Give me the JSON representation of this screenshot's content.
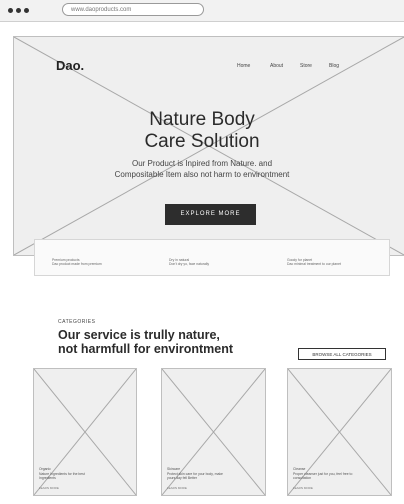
{
  "browser": {
    "url": "www.daoproducts.com"
  },
  "nav": {
    "logo": "Dao.",
    "items": [
      "Home",
      "About",
      "Store",
      "Blog"
    ]
  },
  "hero": {
    "title_line1": "Nature Body",
    "title_line2": "Care Solution",
    "subtitle_line1": "Our Product is Inpired from Nature. and",
    "subtitle_line2": "Compositable Item also not harm to environtment",
    "cta": "EXPLORE MORE"
  },
  "features": [
    {
      "line1": "Premium products",
      "line2": "Dao product made from premium"
    },
    {
      "line1": "Dry in natural",
      "line2": "Don't dry yo, face naturally"
    },
    {
      "line1": "Goody for planet",
      "line2": "Dao minimal treatment to our planet"
    }
  ],
  "categories": {
    "label": "CATEGORIES",
    "title_line1": "Our service is trully nature,",
    "title_line2": "not harmfull for environtment",
    "browse": "BROWSE ALL CATEGORIES",
    "cards": [
      {
        "tag": "Organic",
        "desc": "Nature Ingredients for the best Ingredients",
        "link": "LEARN MORE"
      },
      {
        "tag": "Skincare",
        "desc": "Protect skin care for your body, make yours day fell Better",
        "link": "LEARN MORE"
      },
      {
        "tag": "Cleanse",
        "desc": "Proper cleanser just for you, feel free to consultation",
        "link": "LEARN MORE"
      }
    ]
  }
}
